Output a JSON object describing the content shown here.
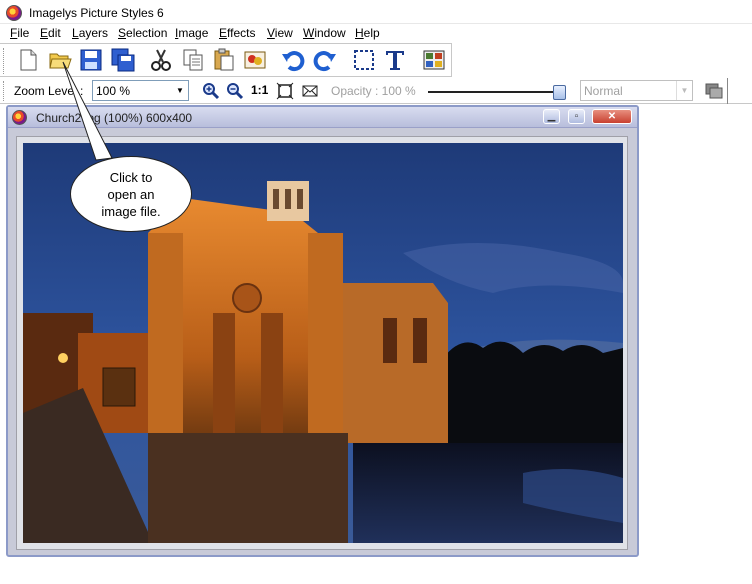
{
  "app": {
    "title": "Imagelys Picture Styles 6"
  },
  "menu": [
    {
      "label": "File"
    },
    {
      "label": "Edit"
    },
    {
      "label": "Layers"
    },
    {
      "label": "Selection"
    },
    {
      "label": "Image"
    },
    {
      "label": "Effects"
    },
    {
      "label": "View"
    },
    {
      "label": "Window"
    },
    {
      "label": "Help"
    }
  ],
  "toolbar": {
    "icons": [
      "new-file-icon",
      "open-folder-icon",
      "save-icon",
      "save-all-icon",
      "cut-icon",
      "copy-icon",
      "paste-icon",
      "paste-special-icon",
      "undo-icon",
      "redo-icon",
      "selection-icon",
      "text-icon",
      "image-grid-icon"
    ]
  },
  "options": {
    "zoom_label": "Zoom Level :",
    "zoom_value": "100 %",
    "ratio_label": "1:1",
    "opacity_label": "Opacity : 100 %",
    "opacity_value": 1.0,
    "blend_mode": "Normal"
  },
  "document": {
    "title": "Church2.jpg (100%) 600x400"
  },
  "callout": {
    "lines": [
      "Click to",
      "open an",
      "image file."
    ]
  }
}
